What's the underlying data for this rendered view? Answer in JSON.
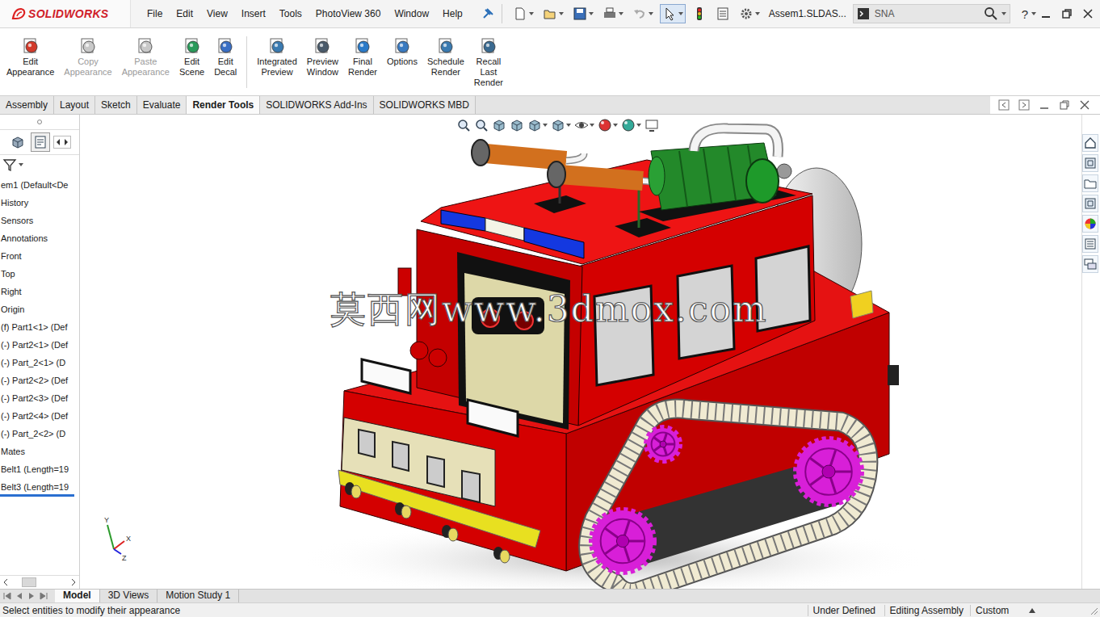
{
  "app": {
    "logo": "SOLIDWORKS"
  },
  "menu": [
    "File",
    "Edit",
    "View",
    "Insert",
    "Tools",
    "PhotoView 360",
    "Window",
    "Help"
  ],
  "document_title": "Assem1.SLDAS...",
  "search": {
    "placeholder": "SNA"
  },
  "help": "?",
  "ribbon": [
    {
      "label": "Edit Appearance",
      "disabled": false
    },
    {
      "label": "Copy Appearance",
      "disabled": true
    },
    {
      "label": "Paste Appearance",
      "disabled": true
    },
    {
      "label": "Edit Scene",
      "disabled": false
    },
    {
      "label": "Edit Decal",
      "disabled": false
    },
    {
      "label": "Integrated Preview",
      "disabled": false
    },
    {
      "label": "Preview Window",
      "disabled": false
    },
    {
      "label": "Final Render",
      "disabled": false
    },
    {
      "label": "Options",
      "disabled": false
    },
    {
      "label": "Schedule Render",
      "disabled": false
    },
    {
      "label": "Recall Last Render",
      "disabled": false
    }
  ],
  "tabs": [
    {
      "label": "Assembly",
      "selected": false
    },
    {
      "label": "Layout",
      "selected": false
    },
    {
      "label": "Sketch",
      "selected": false
    },
    {
      "label": "Evaluate",
      "selected": false
    },
    {
      "label": "Render Tools",
      "selected": true
    },
    {
      "label": "SOLIDWORKS Add-Ins",
      "selected": false
    },
    {
      "label": "SOLIDWORKS MBD",
      "selected": false
    }
  ],
  "tree": {
    "items": [
      "em1 (Default<De",
      "History",
      "Sensors",
      "Annotations",
      "Front",
      "Top",
      "Right",
      "Origin",
      "(f) Part1<1> (Def",
      "(-) Part2<1> (Def",
      "(-) Part_2<1> (D",
      "(-) Part2<2> (Def",
      "(-) Part2<3> (Def",
      "(-) Part2<4> (Def",
      "(-) Part_2<2> (D",
      "Mates",
      "Belt1 (Length=19",
      "Belt3 (Length=19"
    ]
  },
  "viewport": {
    "watermark": "莫西网www.3dmox.com",
    "triad": {
      "y": "Y",
      "x": "X",
      "z": "Z"
    }
  },
  "bottom_tabs": [
    {
      "label": "Model",
      "selected": true
    },
    {
      "label": "3D Views",
      "selected": false
    },
    {
      "label": "Motion Study 1",
      "selected": false
    }
  ],
  "status_bar": {
    "message": "Select entities to modify their appearance",
    "fields": [
      "Under Defined",
      "Editing Assembly",
      "Custom"
    ]
  }
}
